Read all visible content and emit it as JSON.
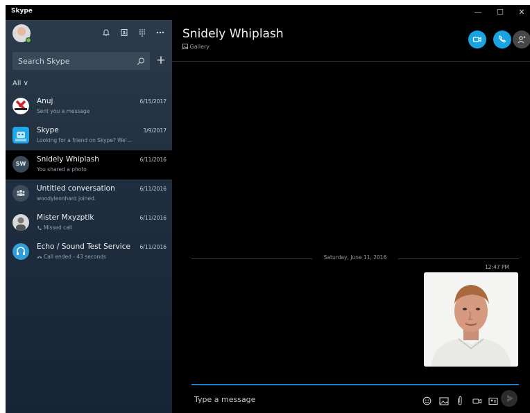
{
  "window": {
    "app_title": "Skype",
    "controls": {
      "minimize": "—",
      "maximize": "☐",
      "close": "✕"
    }
  },
  "sidebar": {
    "profile": {
      "presence": "online"
    },
    "top_icons": [
      "notifications-bell-icon",
      "contacts-book-icon",
      "dialpad-icon",
      "more-icon"
    ],
    "search": {
      "placeholder": "Search Skype"
    },
    "new_chat_label": "+",
    "filter_label": "All ∨",
    "conversations": [
      {
        "name": "Anuj",
        "preview": "Sent you a message",
        "date": "6/15/2017"
      },
      {
        "name": "Skype",
        "preview": "Looking for a friend on Skype? We'...",
        "date": "3/9/2017"
      },
      {
        "name": "Snidely Whiplash",
        "preview": "You shared a photo",
        "date": "6/11/2016",
        "initials": "SW",
        "active": true
      },
      {
        "name": "Untitled conversation",
        "preview": "woodyleonhard joined.",
        "date": "6/11/2016"
      },
      {
        "name": "Mister Mxyzptlk",
        "preview": "Missed call",
        "date": "6/11/2016"
      },
      {
        "name": "Echo / Sound Test Service",
        "preview": "Call ended - 43 seconds",
        "date": "6/11/2016"
      }
    ]
  },
  "chat": {
    "title": "Snidely Whiplash",
    "subtitle": "Gallery",
    "header_buttons": [
      "video-call",
      "audio-call",
      "add-people"
    ],
    "accent": "#19a3e0",
    "date_separator": "Saturday, June 11, 2016",
    "message": {
      "time": "12:47 PM",
      "type": "photo"
    },
    "composer": {
      "placeholder": "Type a message"
    }
  }
}
